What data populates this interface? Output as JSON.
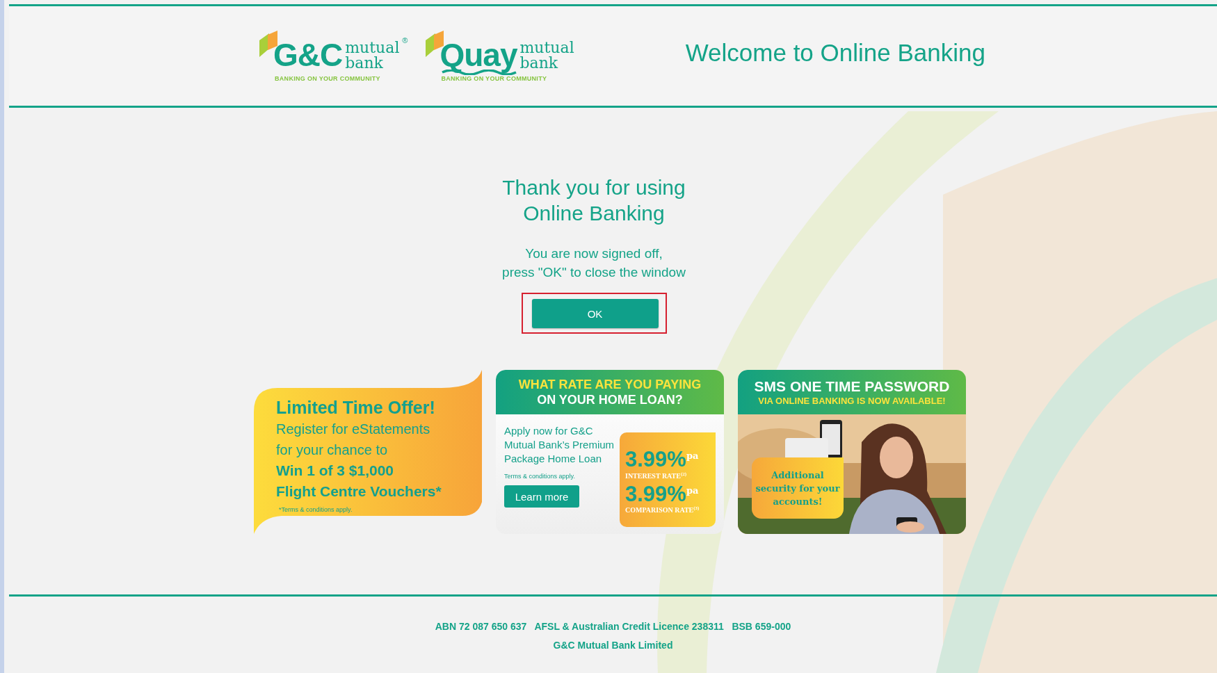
{
  "header": {
    "logos": [
      {
        "kind": "plain",
        "mark": "G&C",
        "word_top": "mutual",
        "word_bottom": "bank",
        "registered": "®",
        "tagline": "BANKING ON YOUR COMMUNITY"
      },
      {
        "kind": "wave",
        "mark": "Quay",
        "word_top": "mutual",
        "word_bottom": "bank",
        "tagline": "BANKING ON YOUR COMMUNITY"
      }
    ],
    "title": "Welcome to Online Banking"
  },
  "message": {
    "heading_lines": [
      "Thank you for using",
      "Online Banking"
    ],
    "body_lines": [
      "You are now signed off,",
      "press \"OK\" to close the window"
    ]
  },
  "ok_button": {
    "label": "OK",
    "highlighted": true
  },
  "banners": [
    {
      "kind": "offer",
      "headline": "Limited Time Offer!",
      "lines": [
        "Register for eStatements",
        "for your chance to"
      ],
      "prize_lines": [
        "Win 1 of 3 $1,000",
        "Flight Centre Vouchers*"
      ],
      "note": "*Terms & conditions apply."
    },
    {
      "kind": "rate",
      "header_top": "WHAT RATE ARE YOU PAYING",
      "header_bottom": "ON YOUR HOME LOAN?",
      "body": "Apply now for G&C Mutual Bank’s Premium Package Home Loan",
      "note": "Terms & conditions apply.",
      "button": "Learn more",
      "rates": [
        {
          "value": "3.99%$^{pa}$",
          "label": "INTEREST RATE$^{(2)}$"
        },
        {
          "value": "3.99%$^{pa}$",
          "label": "COMPARISON RATE$^{(3)}$"
        }
      ]
    },
    {
      "kind": "sms",
      "title": "SMS ONE TIME PASSWORD",
      "subtitle": "VIA ONLINE BANKING IS NOW AVAILABLE!",
      "bubble": "Additional security for your accounts!"
    }
  ],
  "footer": {
    "lines": [
      "ABN 72 087 650 637   AFSL & Australian Credit Licence 238311   BSB 659-000",
      "G&C Mutual Bank Limited"
    ]
  }
}
